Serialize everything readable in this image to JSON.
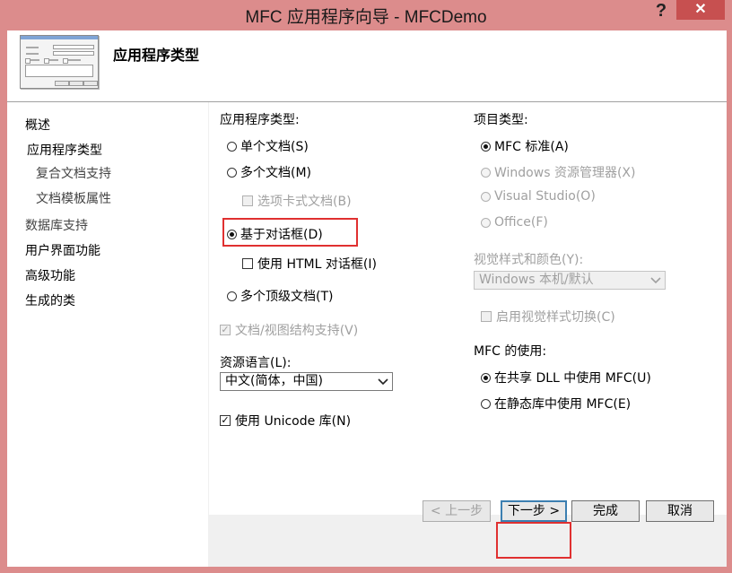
{
  "window": {
    "title": "MFC 应用程序向导 - MFCDemo",
    "help": "?",
    "close": "✕"
  },
  "header": {
    "page_title": "应用程序类型"
  },
  "nav": {
    "items": [
      {
        "label": "概述"
      },
      {
        "label": "应用程序类型"
      },
      {
        "label": "复合文档支持"
      },
      {
        "label": "文档模板属性"
      },
      {
        "label": "数据库支持"
      },
      {
        "label": "用户界面功能"
      },
      {
        "label": "高级功能"
      },
      {
        "label": "生成的类"
      }
    ]
  },
  "app_type": {
    "label": "应用程序类型:",
    "single_doc": "单个文档(S)",
    "multi_doc": "多个文档(M)",
    "tabbed_docs": "选项卡式文档(B)",
    "dialog_based": "基于对话框(D)",
    "use_html_dialog": "使用 HTML 对话框(I)",
    "multi_top_level": "多个顶级文档(T)",
    "doc_view_support": "文档/视图结构支持(V)",
    "selected": "dialog_based"
  },
  "resource_language": {
    "label": "资源语言(L):",
    "value": "中文(简体，中国)"
  },
  "unicode": {
    "label": "使用 Unicode 库(N)",
    "checked": true
  },
  "project_type": {
    "label": "项目类型:",
    "mfc_standard": "MFC 标准(A)",
    "windows_explorer": "Windows 资源管理器(X)",
    "visual_studio": "Visual Studio(O)",
    "office": "Office(F)",
    "selected": "mfc_standard"
  },
  "visual_style": {
    "label": "视觉样式和颜色(Y):",
    "value": "Windows 本机/默认",
    "enable_switching": "启用视觉样式切换(C)"
  },
  "mfc_use": {
    "label": "MFC 的使用:",
    "shared_dll": "在共享 DLL 中使用 MFC(U)",
    "static_lib": "在静态库中使用 MFC(E)",
    "selected": "shared_dll"
  },
  "buttons": {
    "prev": "< 上一步",
    "next": "下一步 >",
    "finish": "完成",
    "cancel": "取消"
  },
  "colors": {
    "titlebar": "#dc8c8c",
    "close": "#c75050",
    "highlight": "#e03030"
  }
}
